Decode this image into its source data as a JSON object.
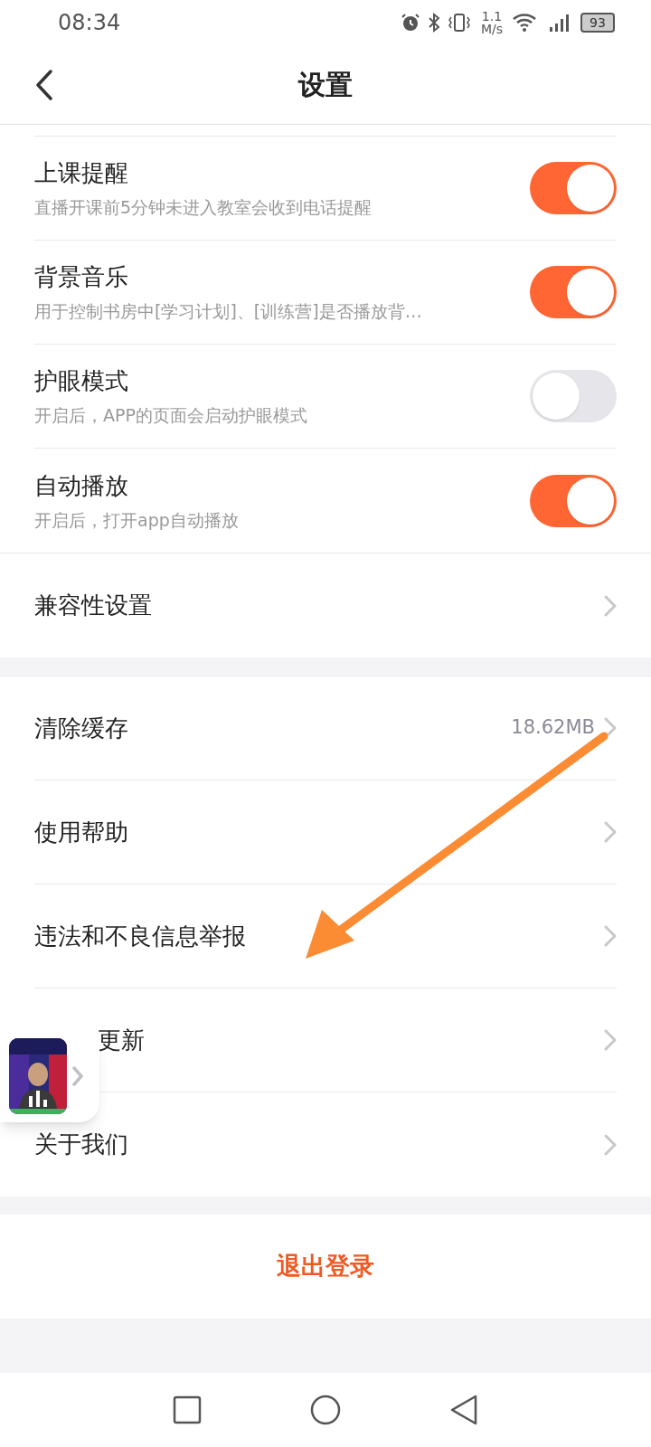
{
  "status_bar": {
    "time": "08:34",
    "speed_value": "1.1",
    "speed_unit": "M/s",
    "battery": "93"
  },
  "header": {
    "title": "设置"
  },
  "toggles": [
    {
      "title": "上课提醒",
      "subtitle": "直播开课前5分钟未进入教室会收到电话提醒",
      "on": true
    },
    {
      "title": "背景音乐",
      "subtitle": "用于控制书房中[学习计划]、[训练营]是否播放背…",
      "on": true
    },
    {
      "title": "护眼模式",
      "subtitle": "开启后，APP的页面会启动护眼模式",
      "on": false
    },
    {
      "title": "自动播放",
      "subtitle": "开启后，打开app自动播放",
      "on": true
    }
  ],
  "group_1": [
    {
      "label": "兼容性设置"
    }
  ],
  "group_2": [
    {
      "label": "清除缓存",
      "value": "18.62MB"
    },
    {
      "label": "使用帮助"
    },
    {
      "label": "违法和不良信息举报"
    },
    {
      "label": "更新"
    },
    {
      "label": "关于我们"
    }
  ],
  "logout": "退出登录"
}
